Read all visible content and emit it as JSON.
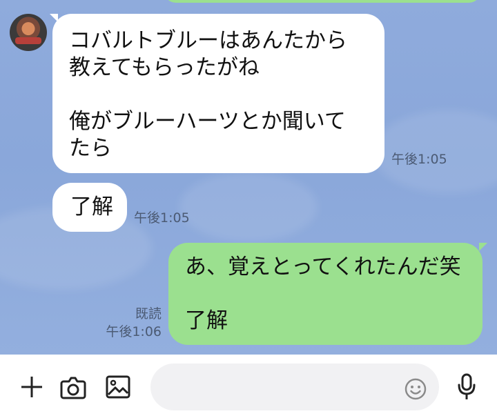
{
  "messages": [
    {
      "side": "left",
      "text": "コバルトブルーはあんたから\n教えてもらったがね\n\n俺がブルーハーツとか聞いて\nたら",
      "time": "午後1:05"
    },
    {
      "side": "left",
      "text": "了解",
      "time": "午後1:05"
    },
    {
      "side": "right",
      "text": "あ、覚えとってくれたんだ笑\n\n了解",
      "read": "既読",
      "time": "午後1:06"
    }
  ],
  "input": {
    "placeholder": ""
  },
  "icons": {
    "add": "plus-icon",
    "camera": "camera-icon",
    "image": "image-icon",
    "emoji": "emoji-icon",
    "mic": "microphone-icon"
  },
  "colors": {
    "chat_background": "#8fabdc",
    "outgoing_bubble": "#9be08f",
    "incoming_bubble": "#ffffff",
    "meta_text": "#4b5a73"
  }
}
